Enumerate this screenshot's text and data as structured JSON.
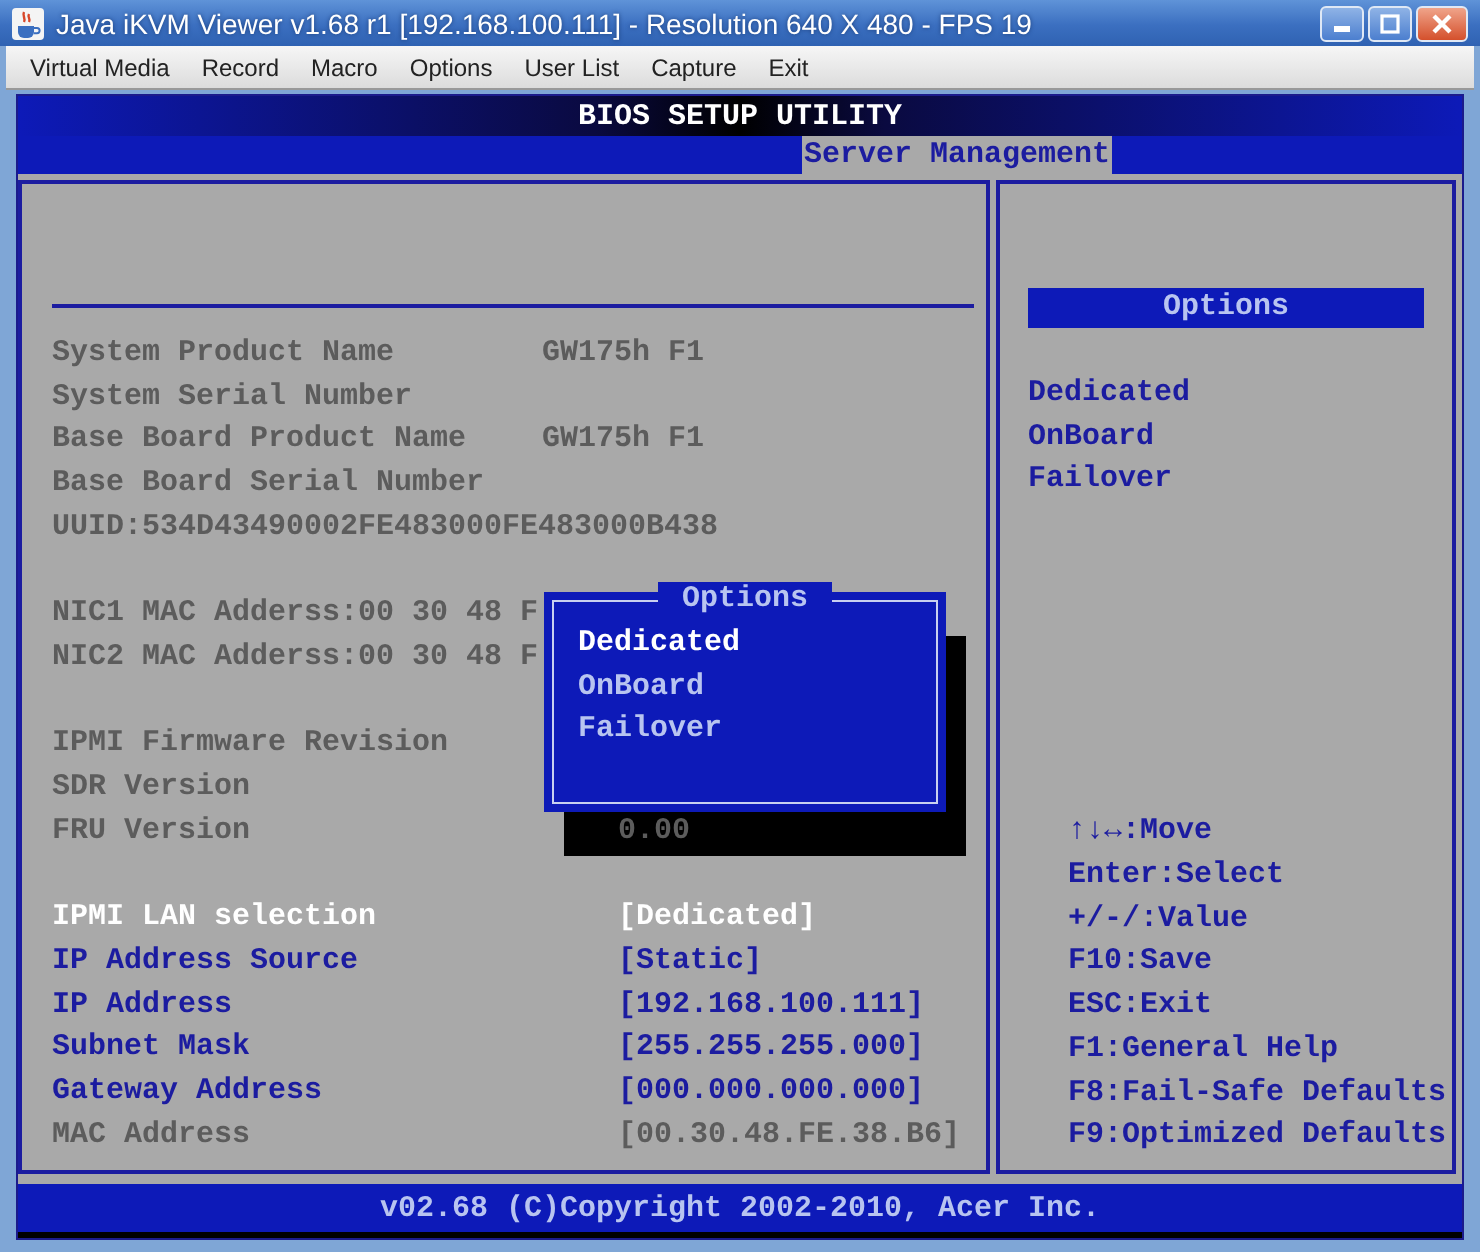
{
  "window": {
    "title": "Java iKVM Viewer v1.68 r1 [192.168.100.111] - Resolution 640 X 480 - FPS 19"
  },
  "menu": [
    "Virtual Media",
    "Record",
    "Macro",
    "Options",
    "User List",
    "Capture",
    "Exit"
  ],
  "bios": {
    "title": "BIOS SETUP UTILITY",
    "tabs": [
      {
        "label": "Server Management",
        "selected": true
      }
    ],
    "info_groups": [
      {
        "rows": [
          {
            "label": "System Product Name",
            "value": "GW175h F1"
          },
          {
            "label": "System Serial Number"
          },
          {
            "label": "Base Board Product Name",
            "value": "GW175h F1"
          },
          {
            "label": "Base Board Serial Number"
          },
          {
            "label": "UUID:534D43490002FE483000FE483000B438"
          }
        ]
      },
      {
        "rows": [
          {
            "label": "NIC1 MAC Adderss:00 30 48 F"
          },
          {
            "label": "NIC2 MAC Adderss:00 30 48 F"
          }
        ]
      },
      {
        "rows": [
          {
            "label": "IPMI Firmware Revision"
          },
          {
            "label": "SDR Version"
          },
          {
            "label": "FRU Version",
            "value": "0.00"
          }
        ]
      }
    ],
    "settings": [
      {
        "label": "IPMI LAN selection",
        "value": "[Dedicated]",
        "selected": true,
        "disabled": false
      },
      {
        "label": "IP Address Source",
        "value": "[Static]",
        "selected": false,
        "disabled": false
      },
      {
        "label": "IP Address",
        "value": "[192.168.100.111]",
        "selected": false,
        "disabled": false
      },
      {
        "label": "Subnet Mask",
        "value": "[255.255.255.000]",
        "selected": false,
        "disabled": false
      },
      {
        "label": "Gateway Address",
        "value": "[000.000.000.000]",
        "selected": false,
        "disabled": false
      },
      {
        "label": "MAC Address",
        "value": "[00.30.48.FE.38.B6]",
        "selected": false,
        "disabled": true
      }
    ],
    "popup": {
      "title": "Options",
      "items": [
        {
          "label": "Dedicated",
          "selected": true
        },
        {
          "label": "OnBoard",
          "selected": false
        },
        {
          "label": "Failover",
          "selected": false
        }
      ]
    },
    "options_panel": {
      "title": "Options",
      "items": [
        "Dedicated",
        "OnBoard",
        "Failover"
      ]
    },
    "help": [
      "↑↓↔:Move",
      "Enter:Select",
      "+/-/:Value",
      "F10:Save",
      "ESC:Exit",
      "F1:General Help",
      "F8:Fail-Safe Defaults",
      "F9:Optimized Defaults"
    ],
    "footer": "v02.68 (C)Copyright 2002-2010, Acer Inc."
  }
}
